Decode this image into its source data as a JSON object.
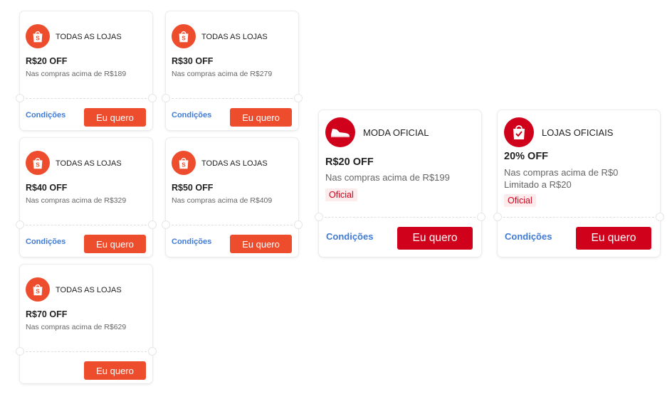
{
  "colors": {
    "shopee_orange": "#ee4d2d",
    "official_red": "#d0011b",
    "link_blue": "#3f7bd5"
  },
  "store_vouchers": [
    {
      "store": "TODAS AS LOJAS",
      "discount": "R$20 OFF",
      "condition": "Nas compras acima de R$189",
      "conditions_link": "Condições",
      "cta": "Eu quero",
      "icon": "shopee-bag-icon"
    },
    {
      "store": "TODAS AS LOJAS",
      "discount": "R$30 OFF",
      "condition": "Nas compras acima de R$279",
      "conditions_link": "Condições",
      "cta": "Eu quero",
      "icon": "shopee-bag-icon"
    },
    {
      "store": "TODAS AS LOJAS",
      "discount": "R$40 OFF",
      "condition": "Nas compras acima de R$329",
      "conditions_link": "Condições",
      "cta": "Eu quero",
      "icon": "shopee-bag-icon"
    },
    {
      "store": "TODAS AS LOJAS",
      "discount": "R$50 OFF",
      "condition": "Nas compras acima de R$409",
      "conditions_link": "Condições",
      "cta": "Eu quero",
      "icon": "shopee-bag-icon"
    },
    {
      "store": "TODAS AS LOJAS",
      "discount": "R$70 OFF",
      "condition": "Nas compras acima de R$629",
      "conditions_link": "",
      "cta": "Eu quero",
      "icon": "shopee-bag-icon"
    }
  ],
  "official_vouchers": [
    {
      "store": "MODA OFICIAL",
      "discount": "R$20 OFF",
      "condition": "Nas compras acima de R$199",
      "limit": "",
      "tag": "Oficial",
      "conditions_link": "Condições",
      "cta": "Eu quero",
      "icon": "sneaker-icon"
    },
    {
      "store": "LOJAS OFICIAIS",
      "discount": "20% OFF",
      "condition": "Nas compras acima de R$0",
      "limit": "Limitado a R$20",
      "tag": "Oficial",
      "conditions_link": "Condições",
      "cta": "Eu quero",
      "icon": "verified-bag-icon"
    }
  ]
}
